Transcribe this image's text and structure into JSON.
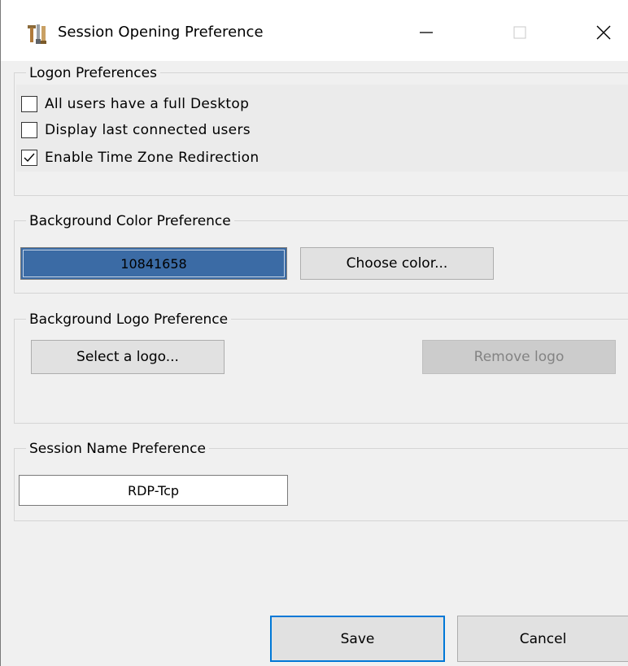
{
  "window": {
    "title": "Session Opening Preference",
    "app_icon": "tool-icon",
    "controls": {
      "minimize": "minimize-icon",
      "maximize": "maximize-icon",
      "close": "close-icon"
    }
  },
  "logon": {
    "legend": "Logon Preferences",
    "options": [
      {
        "label": "All users have a full Desktop",
        "checked": false
      },
      {
        "label": "Display last connected users",
        "checked": false
      },
      {
        "label": "Enable Time Zone Redirection",
        "checked": true
      }
    ]
  },
  "background_color": {
    "legend": "Background Color Preference",
    "value": "10841658",
    "swatch_color": "#3b6ba5",
    "choose_label": "Choose color..."
  },
  "background_logo": {
    "legend": "Background Logo Preference",
    "select_label": "Select a logo...",
    "remove_label": "Remove logo",
    "remove_enabled": false
  },
  "session_name": {
    "legend": "Session Name Preference",
    "value": "RDP-Tcp"
  },
  "footer": {
    "save_label": "Save",
    "cancel_label": "Cancel"
  }
}
